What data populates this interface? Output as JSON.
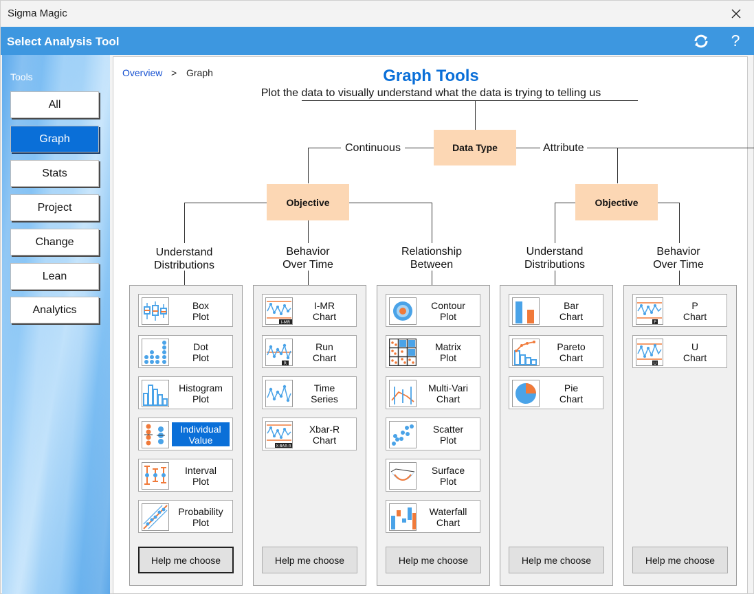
{
  "window": {
    "title": "Sigma Magic"
  },
  "header": {
    "title": "Select Analysis Tool"
  },
  "sidebar": {
    "label": "Tools",
    "items": [
      {
        "label": "All"
      },
      {
        "label": "Graph"
      },
      {
        "label": "Stats"
      },
      {
        "label": "Project"
      },
      {
        "label": "Change"
      },
      {
        "label": "Lean"
      },
      {
        "label": "Analytics"
      }
    ],
    "active": "Graph"
  },
  "breadcrumb": {
    "root": "Overview",
    "separator": ">",
    "current": "Graph"
  },
  "page": {
    "title": "Graph Tools",
    "subtitle": "Plot the data to visually understand what the data is trying to telling us"
  },
  "tree": {
    "root": "Data Type",
    "branches": {
      "left": "Continuous",
      "right": "Attribute"
    },
    "objective": "Objective"
  },
  "categories": [
    {
      "title": [
        "Understand",
        "Distributions"
      ],
      "tools": [
        {
          "name": [
            "Box",
            "Plot"
          ],
          "icon": "box-plot-icon"
        },
        {
          "name": [
            "Dot",
            "Plot"
          ],
          "icon": "dot-plot-icon"
        },
        {
          "name": [
            "Histogram",
            "Plot"
          ],
          "icon": "histogram-icon"
        },
        {
          "name": [
            "Individual",
            "Value"
          ],
          "icon": "individual-value-icon",
          "selected": true
        },
        {
          "name": [
            "Interval",
            "Plot"
          ],
          "icon": "interval-plot-icon"
        },
        {
          "name": [
            "Probability",
            "Plot"
          ],
          "icon": "probability-plot-icon"
        }
      ],
      "help": "Help me choose"
    },
    {
      "title": [
        "Behavior",
        "Over Time"
      ],
      "tools": [
        {
          "name": [
            "I-MR",
            "Chart"
          ],
          "icon": "imr-chart-icon",
          "tag": "I-MR"
        },
        {
          "name": [
            "Run",
            "Chart"
          ],
          "icon": "run-chart-icon",
          "tag": "R"
        },
        {
          "name": [
            "Time",
            "Series"
          ],
          "icon": "time-series-icon"
        },
        {
          "name": [
            "Xbar-R",
            "Chart"
          ],
          "icon": "xbar-r-chart-icon",
          "tag": "X-BAR-R"
        }
      ],
      "help": "Help me choose"
    },
    {
      "title": [
        "Relationship",
        "Between"
      ],
      "tools": [
        {
          "name": [
            "Contour",
            "Plot"
          ],
          "icon": "contour-plot-icon"
        },
        {
          "name": [
            "Matrix",
            "Plot"
          ],
          "icon": "matrix-plot-icon"
        },
        {
          "name": [
            "Multi-Vari",
            "Chart"
          ],
          "icon": "multi-vari-icon"
        },
        {
          "name": [
            "Scatter",
            "Plot"
          ],
          "icon": "scatter-plot-icon"
        },
        {
          "name": [
            "Surface",
            "Plot"
          ],
          "icon": "surface-plot-icon"
        },
        {
          "name": [
            "Waterfall",
            "Chart"
          ],
          "icon": "waterfall-chart-icon"
        }
      ],
      "help": "Help me choose"
    },
    {
      "title": [
        "Understand",
        "Distributions"
      ],
      "tools": [
        {
          "name": [
            "Bar",
            "Chart"
          ],
          "icon": "bar-chart-icon"
        },
        {
          "name": [
            "Pareto",
            "Chart"
          ],
          "icon": "pareto-chart-icon"
        },
        {
          "name": [
            "Pie",
            "Chart"
          ],
          "icon": "pie-chart-icon"
        }
      ],
      "help": "Help me choose"
    },
    {
      "title": [
        "Behavior",
        "Over Time"
      ],
      "tools": [
        {
          "name": [
            "P",
            "Chart"
          ],
          "icon": "p-chart-icon",
          "tag": "P"
        },
        {
          "name": [
            "U",
            "Chart"
          ],
          "icon": "u-chart-icon",
          "tag": "U"
        }
      ],
      "help": "Help me choose"
    }
  ],
  "colors": {
    "accent": "#0a6fd8",
    "header": "#3d97e0",
    "peach": "#fcd7b4",
    "icon_blue": "#4aa3e8",
    "icon_orange": "#f07a3a"
  }
}
